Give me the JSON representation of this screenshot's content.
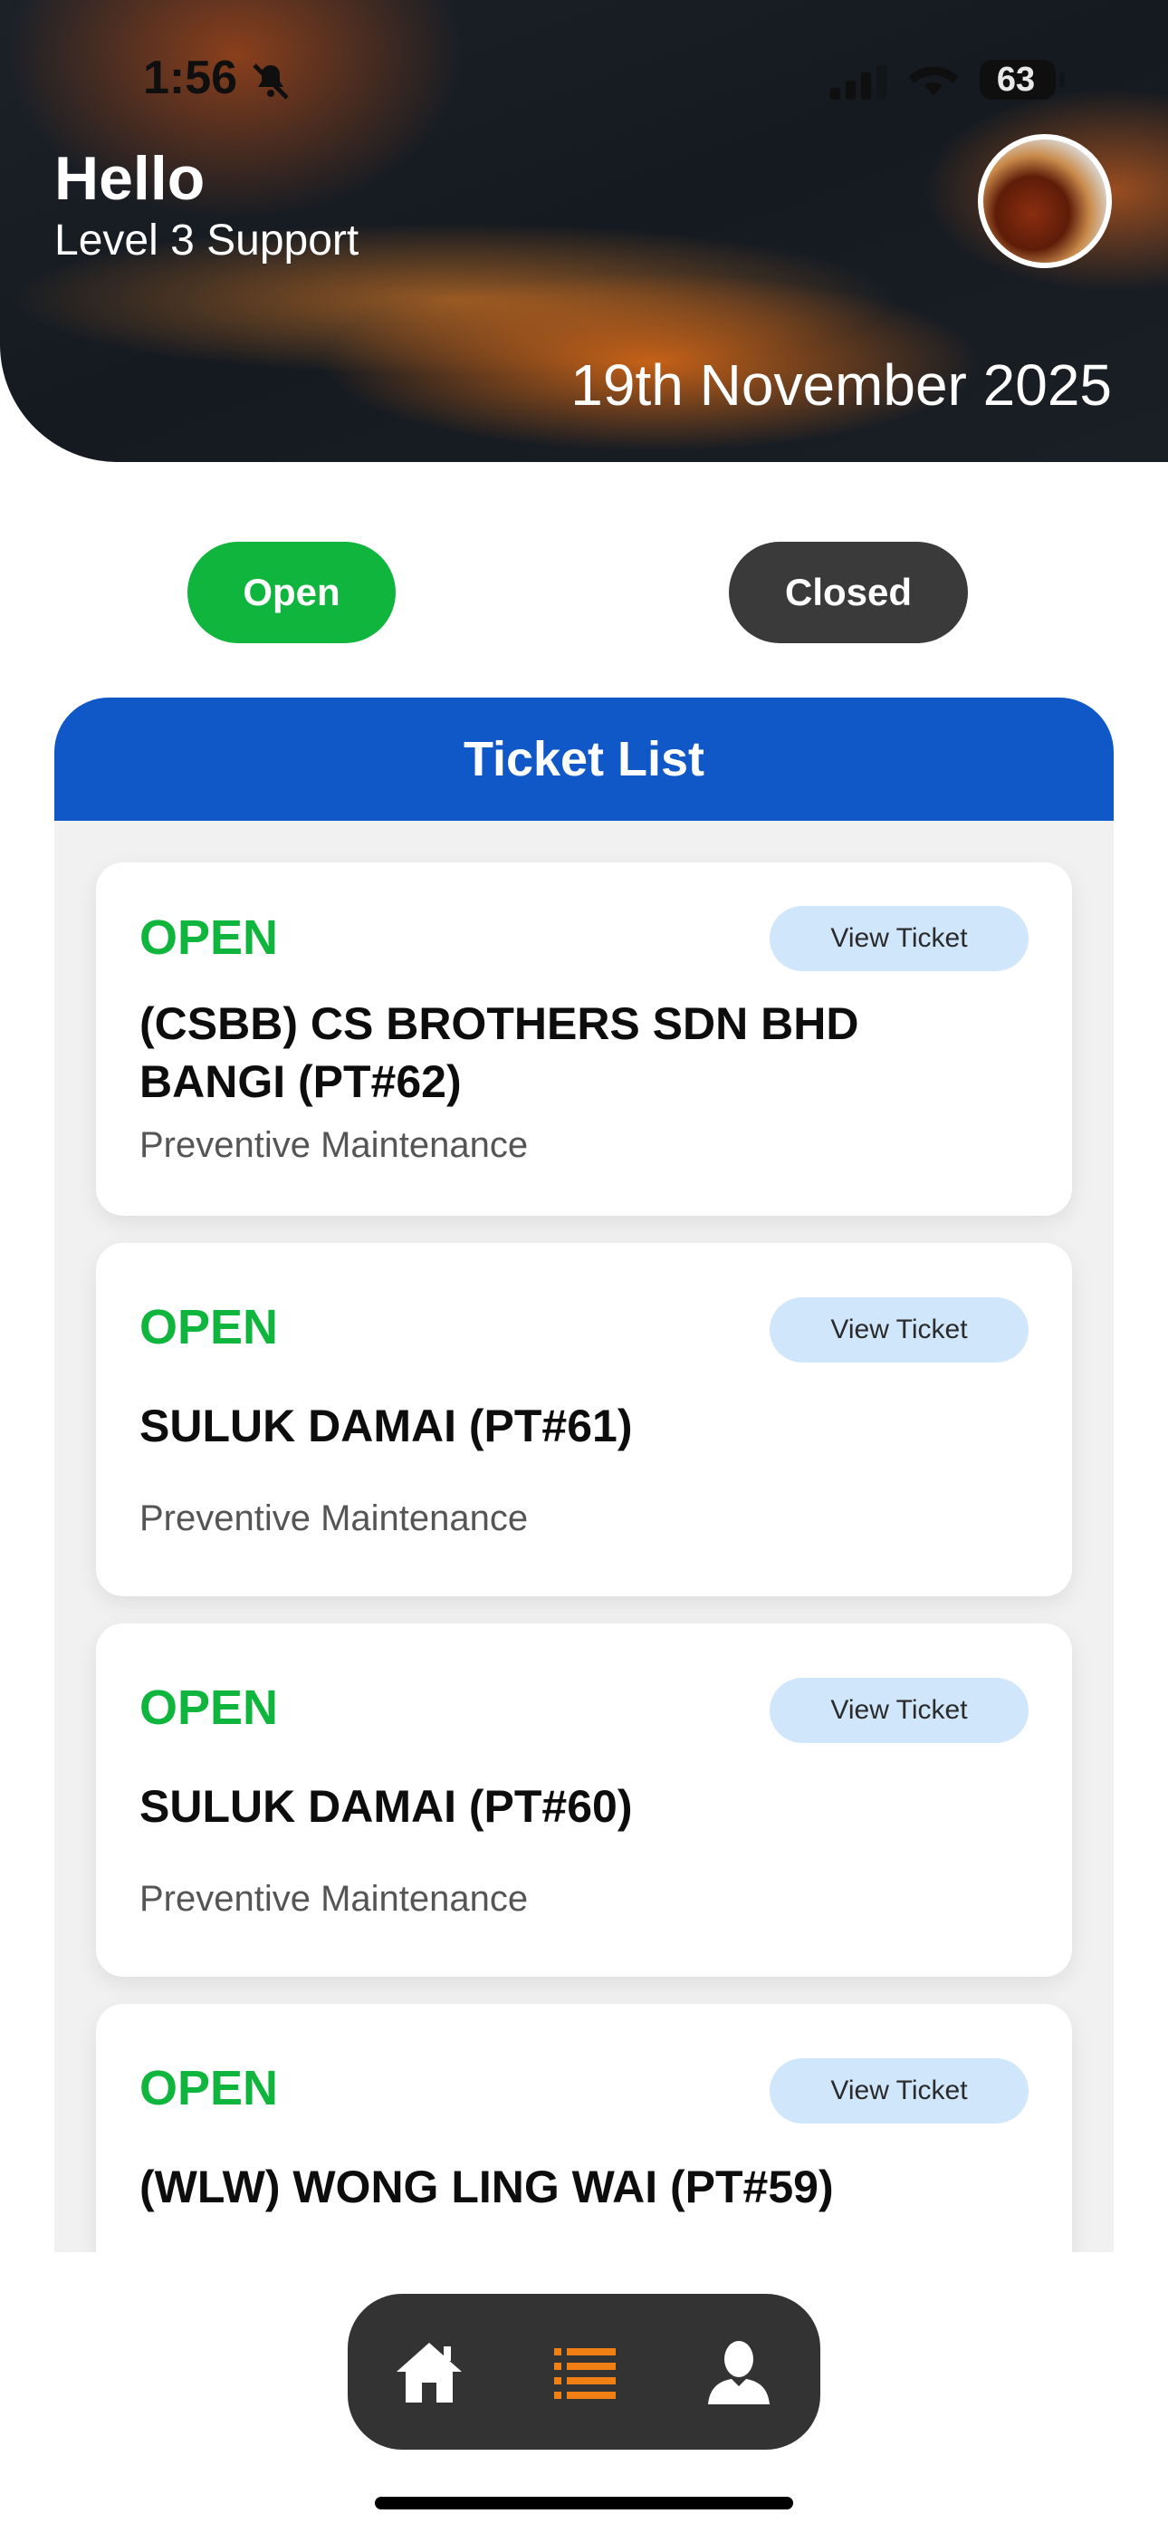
{
  "status_bar": {
    "time": "1:56",
    "battery": "63"
  },
  "header": {
    "greeting": "Hello",
    "role": "Level 3 Support",
    "date": "19th November 2025"
  },
  "filters": {
    "open_label": "Open",
    "closed_label": "Closed",
    "selected": "Open"
  },
  "ticket_list": {
    "title": "Ticket List",
    "view_label": "View Ticket",
    "tickets": [
      {
        "status": "OPEN",
        "title": "(CSBB) CS BROTHERS SDN BHD BANGI (PT#62)",
        "type": "Preventive Maintenance"
      },
      {
        "status": "OPEN",
        "title": "SULUK DAMAI (PT#61)",
        "type": "Preventive Maintenance"
      },
      {
        "status": "OPEN",
        "title": "SULUK DAMAI (PT#60)",
        "type": "Preventive Maintenance"
      },
      {
        "status": "OPEN",
        "title": "(WLW) WONG LING WAI (PT#59)",
        "type": ""
      }
    ]
  },
  "bottom_nav": {
    "items": [
      {
        "icon": "home-icon",
        "active": false
      },
      {
        "icon": "list-icon",
        "active": true
      },
      {
        "icon": "user-icon",
        "active": false
      }
    ]
  },
  "colors": {
    "open_green": "#0fb53c",
    "closed_dark": "#3a3a3a",
    "header_blue": "#1058c7",
    "view_button_bg": "#cfe6fb",
    "nav_active": "#f07f14"
  }
}
